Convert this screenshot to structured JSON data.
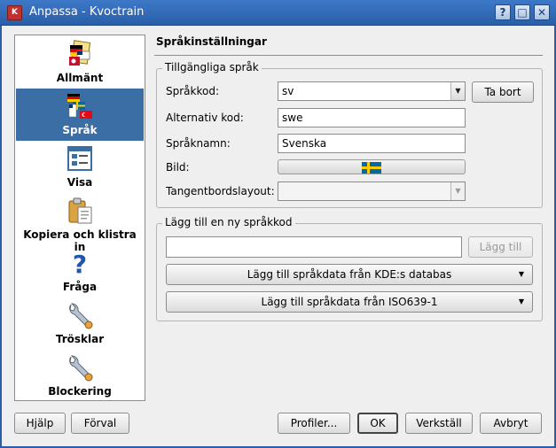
{
  "window": {
    "title": "Anpassa - Kvoctrain",
    "buttons": [
      "?",
      "□",
      "✕"
    ]
  },
  "sidebar": {
    "items": [
      {
        "label": "Allmänt",
        "icon": "general-settings-icon"
      },
      {
        "label": "Språk",
        "icon": "language-flags-icon",
        "selected": true
      },
      {
        "label": "Visa",
        "icon": "view-icon"
      },
      {
        "label": "Kopiera och klistra in",
        "icon": "copy-paste-icon"
      },
      {
        "label": "Fråga",
        "icon": "question-icon"
      },
      {
        "label": "Trösklar",
        "icon": "wrench-icon"
      },
      {
        "label": "Blockering",
        "icon": "wrench-icon"
      }
    ]
  },
  "page": {
    "title": "Språkinställningar"
  },
  "available": {
    "title": "Tillgängliga språk",
    "code_label": "Språkkod:",
    "code_value": "sv",
    "remove_button": "Ta bort",
    "alt_label": "Alternativ kod:",
    "alt_value": "swe",
    "name_label": "Språknamn:",
    "name_value": "Svenska",
    "image_label": "Bild:",
    "keyboard_label": "Tangentbordslayout:",
    "keyboard_value": ""
  },
  "add_new": {
    "title": "Lägg till en ny språkkod",
    "input_value": "",
    "add_button": "Lägg till",
    "kde_button": "Lägg till språkdata från KDE:s databas",
    "iso_button": "Lägg till språkdata från ISO639-1"
  },
  "footer": {
    "help": "Hjälp",
    "defaults": "Förval",
    "profiles": "Profiler...",
    "ok": "OK",
    "apply": "Verkställ",
    "cancel": "Avbryt"
  },
  "colors": {
    "titlebar": "#2a5ea8",
    "selection": "#3a6ea5",
    "sweden_blue": "#006aa7",
    "sweden_yellow": "#fecc00"
  }
}
